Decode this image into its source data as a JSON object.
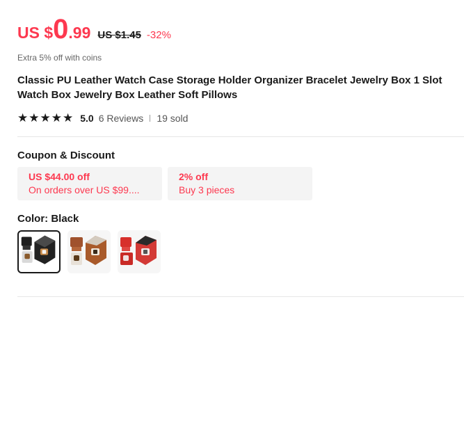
{
  "price": {
    "currency": "US $",
    "integer": "0",
    "decimal": ".99",
    "original": "US $1.45",
    "discount": "-32%"
  },
  "coins_note": "Extra 5% off with coins",
  "product": {
    "title": "Classic PU Leather Watch Case Storage Holder Organizer Bracelet Jewelry Box 1 Slot Watch Box Jewelry Box Leather Soft Pillows"
  },
  "rating": {
    "stars": 5,
    "score": "5.0",
    "reviews": "6 Reviews",
    "sold": "19 sold"
  },
  "coupon_section": {
    "title": "Coupon & Discount",
    "coupons": [
      {
        "line1": "US $44.00 off",
        "line2": "On orders over US $99...."
      },
      {
        "line1": "2% off",
        "line2": "Buy 3 pieces"
      }
    ]
  },
  "color": {
    "label": "Color: Black",
    "options": [
      "black",
      "brown",
      "red"
    ],
    "selected": "black"
  },
  "colors": {
    "accent": "#fd384f",
    "text": "#191919"
  }
}
